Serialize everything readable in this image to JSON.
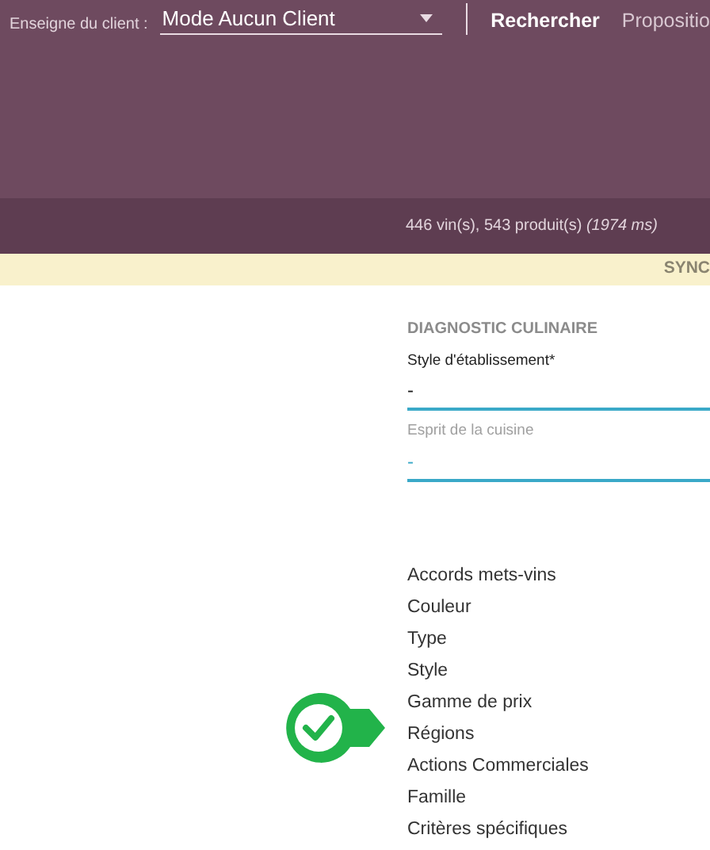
{
  "header": {
    "client_label": "Enseigne du client :",
    "client_select": {
      "value": "Mode Aucun Client"
    },
    "nav": [
      {
        "label": "Rechercher",
        "selected": true
      },
      {
        "label": "Propositio",
        "selected": false
      }
    ]
  },
  "status_bar": {
    "counts": "446 vin(s), 543 produit(s)",
    "timing": "(1974 ms)"
  },
  "notice_bar": {
    "text": "SYNC"
  },
  "section": {
    "title": "DIAGNOSTIC CULINAIRE",
    "fields": [
      {
        "label": "Style d'établissement*",
        "value": "-",
        "disabled": false
      },
      {
        "label": "Esprit de la cuisine",
        "value": "-",
        "disabled": true
      }
    ]
  },
  "filters": [
    {
      "label": "Accords mets-vins",
      "highlighted": false
    },
    {
      "label": "Couleur",
      "highlighted": false
    },
    {
      "label": "Type",
      "highlighted": false
    },
    {
      "label": "Style",
      "highlighted": false
    },
    {
      "label": "Gamme de prix",
      "highlighted": false
    },
    {
      "label": "Régions",
      "highlighted": true
    },
    {
      "label": "Actions Commerciales",
      "highlighted": false
    },
    {
      "label": "Famille",
      "highlighted": false
    },
    {
      "label": "Critères spécifiques",
      "highlighted": false
    }
  ]
}
